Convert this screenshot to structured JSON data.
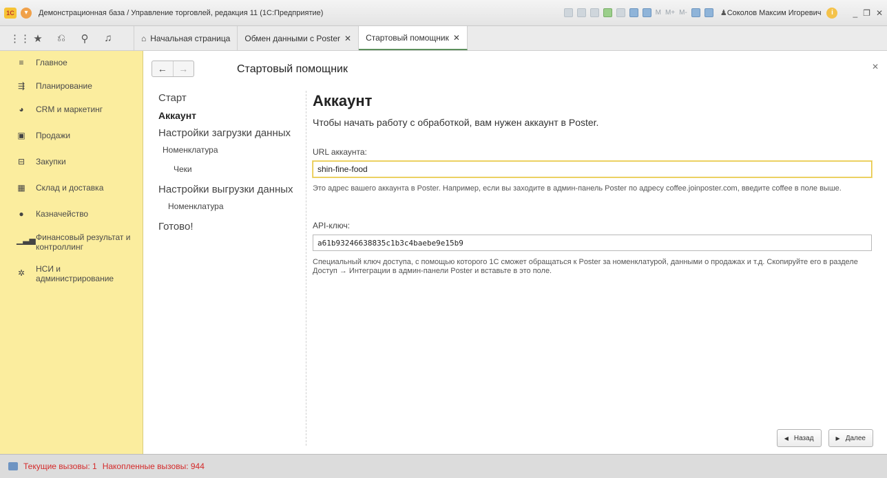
{
  "window": {
    "logo": "1С",
    "title": "Демонстрационная база / Управление торговлей, редакция 11  (1С:Предприятие)",
    "toolbar_m": [
      "M",
      "M+",
      "M-"
    ],
    "user": "Соколов Максим Игоревич",
    "info": "i",
    "controls": [
      "_",
      "❐",
      "✕"
    ]
  },
  "tabs": [
    {
      "label": "Начальная страница",
      "closable": false
    },
    {
      "label": "Обмен данными с Poster",
      "closable": true
    },
    {
      "label": "Стартовый помощник",
      "closable": true,
      "active": true
    }
  ],
  "sidebar": {
    "items": [
      {
        "label": "Главное",
        "icon": "menu-icon"
      },
      {
        "label": "Планирование",
        "icon": "planning-icon"
      },
      {
        "label": "CRM и маркетинг",
        "icon": "pie-chart-icon"
      },
      {
        "label": "Продажи",
        "icon": "shopping-bag-icon"
      },
      {
        "label": "Закупки",
        "icon": "cart-icon"
      },
      {
        "label": "Склад и доставка",
        "icon": "warehouse-icon"
      },
      {
        "label": "Казначейство",
        "icon": "coin-icon"
      },
      {
        "label": "Финансовый результат и контроллинг",
        "icon": "bar-chart-icon"
      },
      {
        "label": "НСИ и администрирование",
        "icon": "gear-icon"
      }
    ]
  },
  "page": {
    "title": "Стартовый помощник",
    "steps": {
      "start": "Старт",
      "account": "Аккаунт",
      "load_settings": "Настройки загрузки данных",
      "load_nomenclature": "Номенклатура",
      "load_checks": "Чеки",
      "upload_settings": "Настройки выгрузки данных",
      "upload_nomenclature": "Номенклатура",
      "done": "Готово!"
    },
    "heading": "Аккаунт",
    "intro": "Чтобы начать работу с обработкой, вам нужен аккаунт в Poster.",
    "url_label": "URL аккаунта:",
    "url_value": "shin-fine-food",
    "url_hint": "Это адрес вашего аккаунта в Poster. Например, если вы заходите в админ-панель Poster по адресу coffee.joinposter.com, введите coffee в поле выше.",
    "api_label": "API-ключ:",
    "api_value": "a61b93246638835c1b3c4baebe9e15b9",
    "api_hint": "Специальный ключ доступа, с помощью которого 1С сможет обращаться к Poster за номенклатурой, данными о продажах и т.д. Скопируйте его в разделе Доступ → Интеграции в админ-панели Poster и вставьте в это поле.",
    "back_label": "Назад",
    "next_label": "Далее"
  },
  "status": {
    "current_calls": "Текущие вызовы: 1",
    "accumulated_calls": "Накопленные вызовы: 944"
  }
}
